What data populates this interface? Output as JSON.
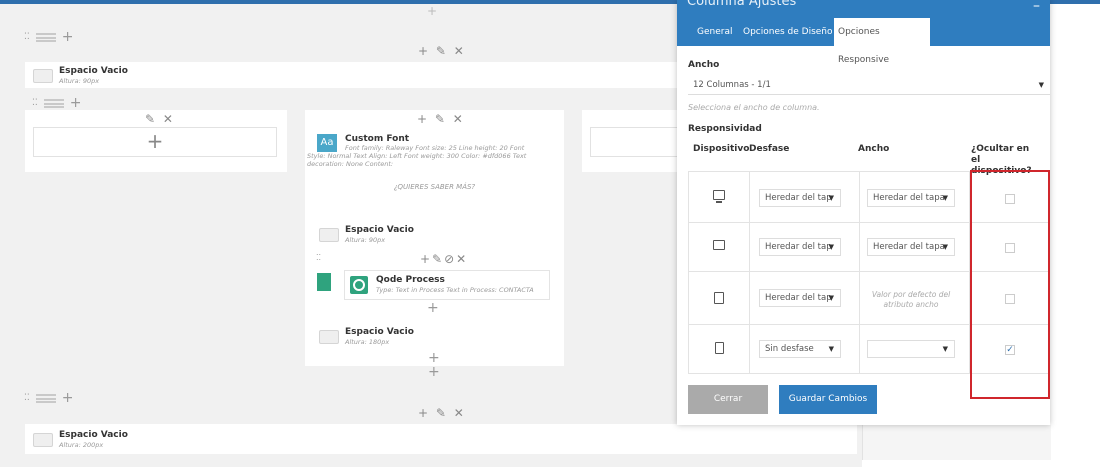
{
  "builder": {
    "plus": "+",
    "controls": "+ ✎ ✕",
    "controls_edit_close": "✎ ✕",
    "controls_full": "+✎⊘✕",
    "dots": "⁚⁚",
    "expand_icon": "expand-icon",
    "rows": [
      {
        "title": "Espacio Vacio",
        "sub": "Altura: 90px"
      },
      {
        "title": "Espacio Vacio",
        "sub": "Altura: 200px"
      }
    ],
    "custom_font": {
      "badge": "Aa",
      "title": "Custom Font",
      "sub": "Font family: Raleway Font size: 25 Line height: 20 Font Style: Normal Text Align: Left Font weight: 300 Color: #dfd066 Text decoration: None Content:",
      "content": "¿QUIERES SABER MÁS?"
    },
    "inner_spacer_1": {
      "title": "Espacio Vacio",
      "sub": "Altura: 90px"
    },
    "process": {
      "title": "Qode Process",
      "sub": "Type: Text in Process Text in Process: CONTACTA"
    },
    "inner_spacer_2": {
      "title": "Espacio Vacio",
      "sub": "Altura: 180px"
    }
  },
  "modal": {
    "title": "Columna Ajustes",
    "minimize": "–",
    "tabs": [
      "General",
      "Opciones de Diseño",
      "Opciones Responsive"
    ],
    "ancho_label": "Ancho",
    "ancho_value": "12 Columnas - 1/1",
    "ancho_hint": "Selecciona el ancho de columna.",
    "responsividad_label": "Responsividad",
    "headers": {
      "device": "Dispositivo",
      "offset": "Desfase",
      "width": "Ancho",
      "hide": "¿Ocultar en el dispositivo?"
    },
    "rows": [
      {
        "device_icon": "desktop-icon",
        "offset": "Heredar del tap",
        "width": "Heredar del tapa",
        "hidden": false
      },
      {
        "device_icon": "tablet-landscape-icon",
        "offset": "Heredar del tap",
        "width": "Heredar del tapa",
        "hidden": false
      },
      {
        "device_icon": "tablet-portrait-icon",
        "offset": "Heredar del tap",
        "width_hint": "Valor por defecto del atributo ancho",
        "hidden": false
      },
      {
        "device_icon": "phone-icon",
        "offset": "Sin desfase",
        "width": "",
        "hidden": true
      }
    ],
    "buttons": {
      "close": "Cerrar",
      "save": "Guardar Cambios"
    },
    "colors": {
      "header": "#2f7dbf",
      "save": "#2f7dbf",
      "close": "#aaaaaa",
      "highlight": "#d0262c"
    }
  }
}
